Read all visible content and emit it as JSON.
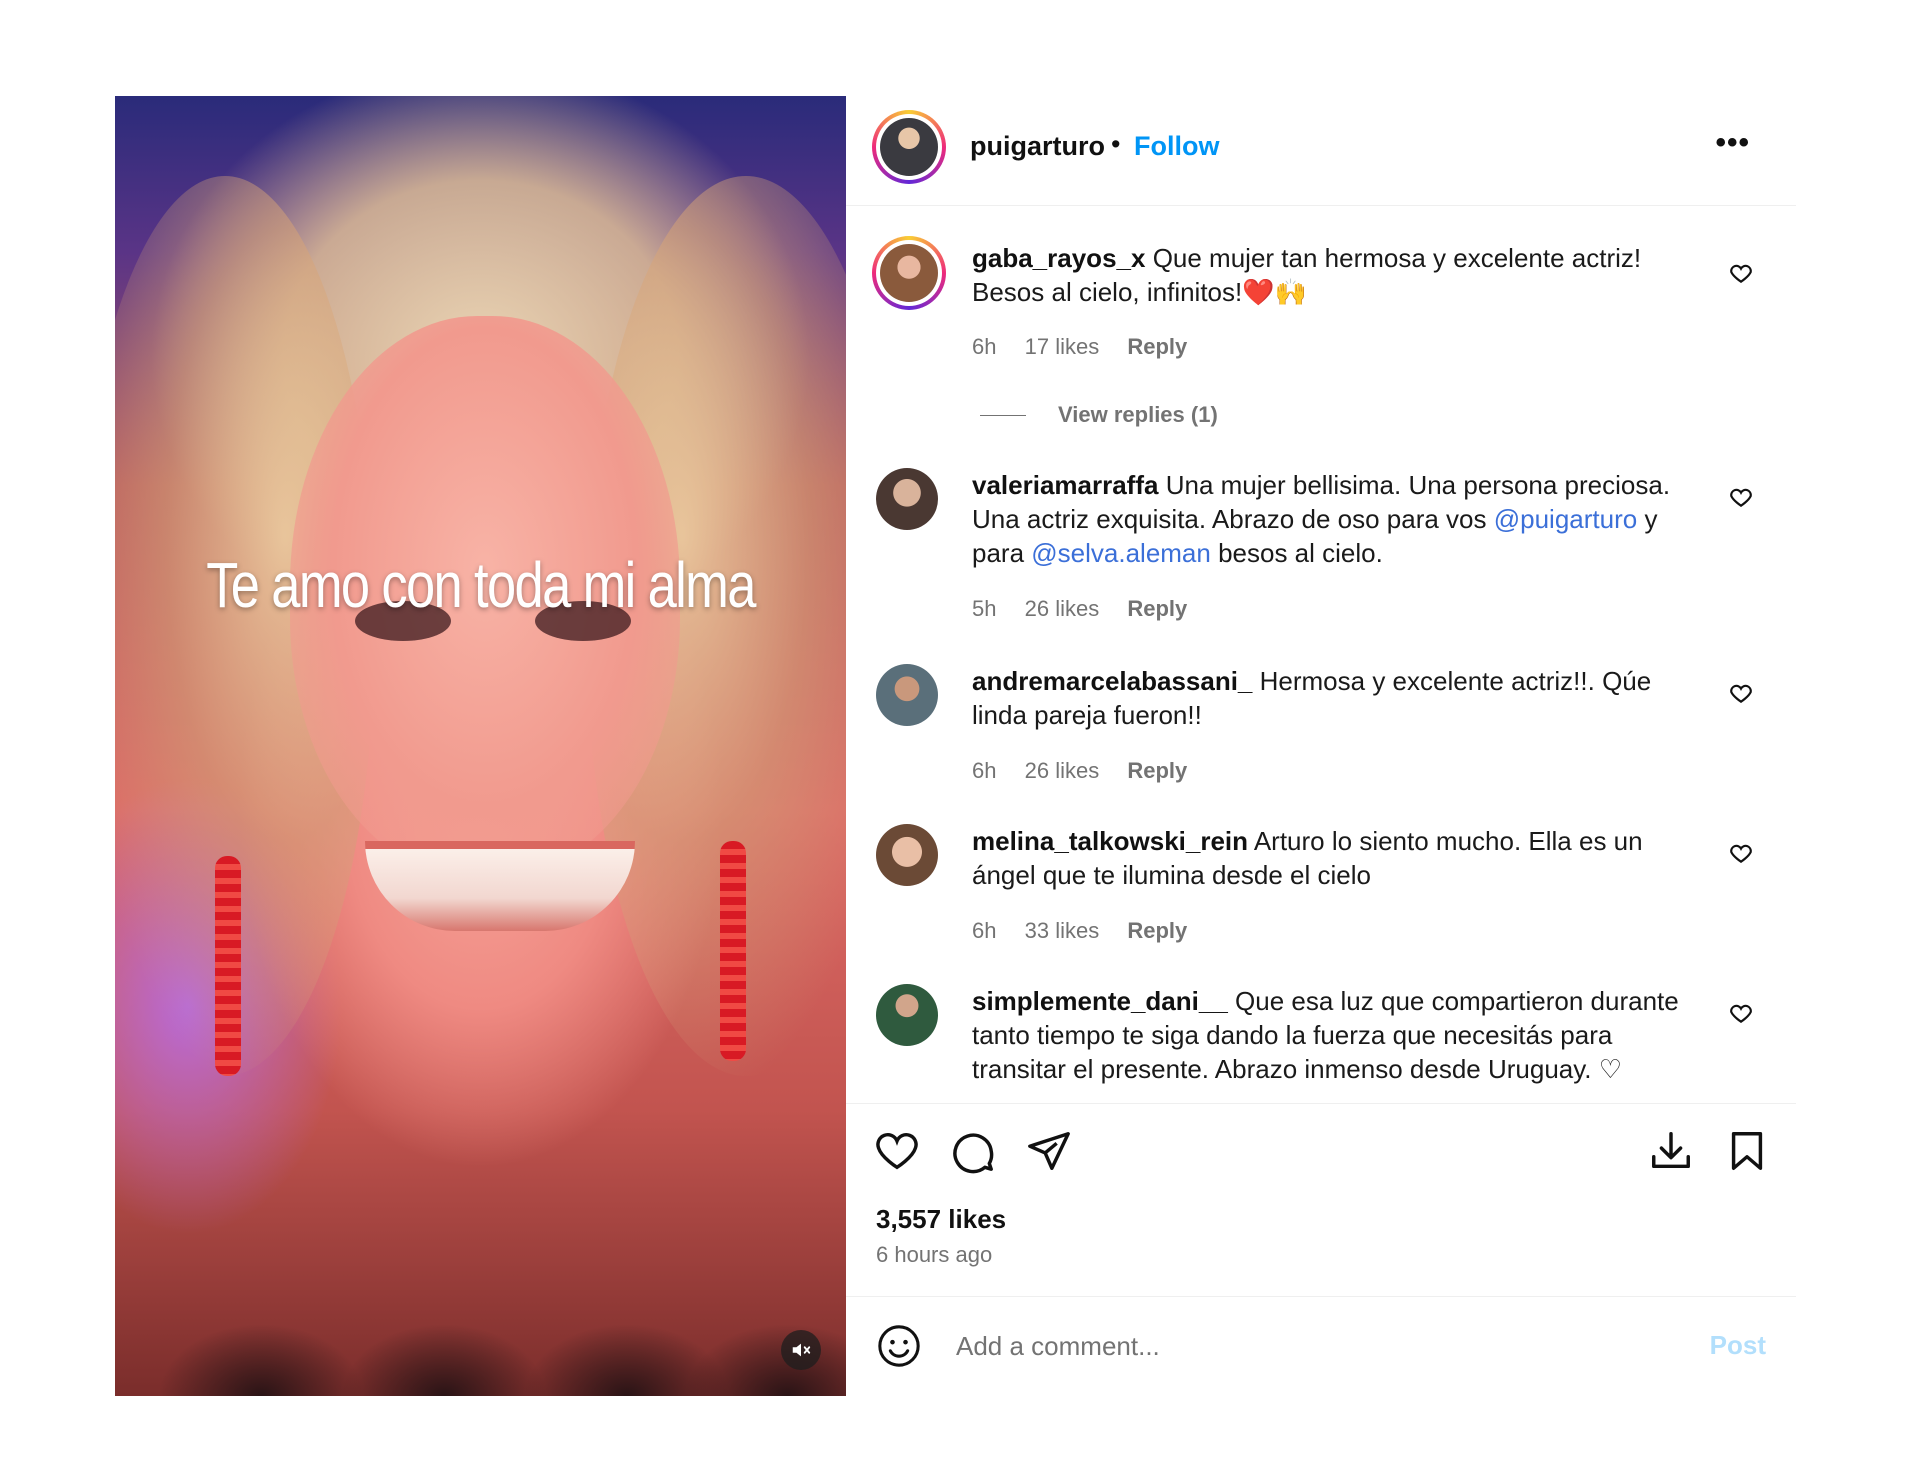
{
  "media": {
    "caption": "Te amo con toda mi alma",
    "mute_icon": "speaker-muted-icon"
  },
  "header": {
    "username": "puigarturo",
    "separator": "•",
    "follow_label": "Follow",
    "more_label": "•••"
  },
  "comments": [
    {
      "username": "gaba_rayos_x",
      "text": "Que mujer tan hermosa y excelente actriz! Besos al cielo, infinitos!❤️🙌",
      "time": "6h",
      "likes": "17 likes",
      "reply": "Reply",
      "view_replies": "View replies (1)"
    },
    {
      "username": "valeriamarraffa",
      "text_parts": [
        "Una mujer bellisima. Una persona preciosa. Una actriz exquisita. Abrazo de oso para vos ",
        "@puigarturo",
        " y para ",
        "@selva.aleman",
        " besos al cielo."
      ],
      "time": "5h",
      "likes": "26 likes",
      "reply": "Reply"
    },
    {
      "username": "andremarcelabassani_",
      "text": "Hermosa y excelente actriz!!. Qúe linda pareja fueron!!",
      "time": "6h",
      "likes": "26 likes",
      "reply": "Reply"
    },
    {
      "username": "melina_talkowski_rein",
      "text": "Arturo lo siento mucho. Ella es un ángel que te ilumina desde el cielo",
      "time": "6h",
      "likes": "33 likes",
      "reply": "Reply"
    },
    {
      "username": "simplemente_dani__",
      "text": "Que esa luz que compartieron durante tanto tiempo te siga dando la fuerza que necesitás para transitar el presente. Abrazo inmenso desde Uruguay. ♡"
    }
  ],
  "footer": {
    "likes": "3,557 likes",
    "time": "6 hours ago",
    "comment_placeholder": "Add a comment...",
    "post_label": "Post"
  },
  "colors": {
    "accent": "#0095f6",
    "mention": "#3b6fd8",
    "muted_text": "#737373",
    "post_disabled": "#b2dffc"
  }
}
